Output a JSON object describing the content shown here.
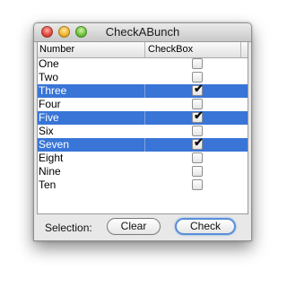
{
  "window": {
    "title": "CheckABunch"
  },
  "table": {
    "columns": [
      "Number",
      "CheckBox"
    ],
    "rows": [
      {
        "label": "One",
        "checked": false,
        "selected": false
      },
      {
        "label": "Two",
        "checked": false,
        "selected": false
      },
      {
        "label": "Three",
        "checked": true,
        "selected": true
      },
      {
        "label": "Four",
        "checked": false,
        "selected": false
      },
      {
        "label": "Five",
        "checked": true,
        "selected": true
      },
      {
        "label": "Six",
        "checked": false,
        "selected": false
      },
      {
        "label": "Seven",
        "checked": true,
        "selected": true
      },
      {
        "label": "Eight",
        "checked": false,
        "selected": false
      },
      {
        "label": "Nine",
        "checked": false,
        "selected": false
      },
      {
        "label": "Ten",
        "checked": false,
        "selected": false
      }
    ]
  },
  "footer": {
    "selection_label": "Selection:",
    "clear_label": "Clear",
    "check_label": "Check"
  },
  "colors": {
    "selection": "#3875d7"
  },
  "icons": [
    "close-icon",
    "minimize-icon",
    "zoom-icon",
    "checkmark-icon"
  ]
}
